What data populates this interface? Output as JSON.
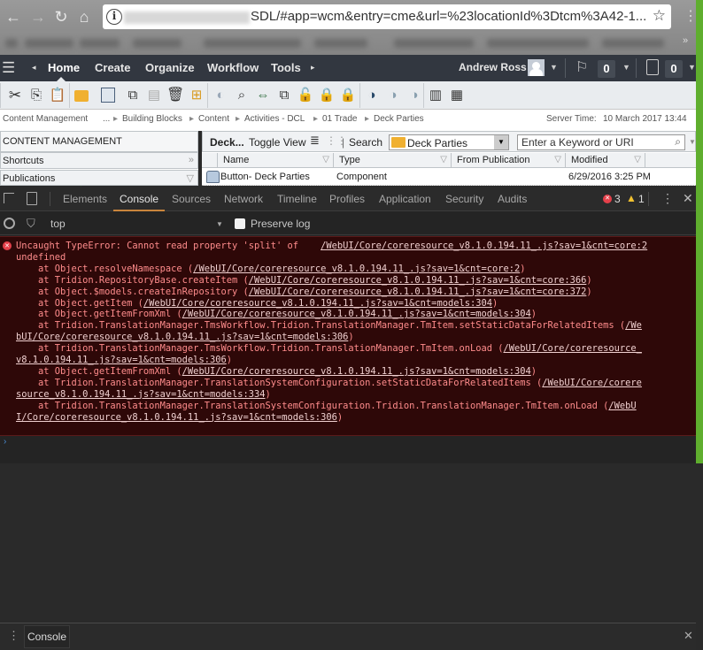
{
  "browser": {
    "url_visible": "SDL/#app=wcm&entry=cme&url=%23locationId%3Dtcm%3A42-1...",
    "more_bookmarks": "»"
  },
  "app_header": {
    "tabs": [
      "Home",
      "Create",
      "Organize",
      "Workflow",
      "Tools"
    ],
    "active_tab": "Home",
    "user_name": "Andrew Ross",
    "flag_count": "0",
    "clipboard_count": "0"
  },
  "toolbar": {
    "icons": [
      "cut",
      "copy",
      "paste",
      "upload-folder",
      "structure",
      "where-used",
      "clipboard",
      "delete",
      "add-item",
      "publish-globe",
      "preview",
      "compare",
      "localize",
      "unlock",
      "lock",
      "checkin",
      "publish-page",
      "publish-green",
      "unpublish-red",
      "barcode-add",
      "barcode-check"
    ]
  },
  "breadcrumb": {
    "root": "Content Management",
    "items": [
      "...",
      "Building Blocks",
      "Content",
      "Activities - DCL",
      "01 Trade",
      "Deck Parties"
    ],
    "server_time_label": "Server Time:",
    "server_time": "10 March 2017 13:44"
  },
  "left_panel": {
    "title": "CONTENT MANAGEMENT",
    "shortcuts": "Shortcuts",
    "publications": "Publications"
  },
  "right_panel": {
    "folder_short": "Deck...",
    "toggle_view": "Toggle View",
    "search_label": "Search",
    "folder_value": "Deck Parties",
    "keyword_placeholder": "Enter a Keyword or URI",
    "columns": [
      "Name",
      "Type",
      "From Publication",
      "Modified"
    ],
    "rows": [
      {
        "name": "Button- Deck Parties",
        "type": "Component",
        "from_publication": "",
        "modified": "6/29/2016 3:25 PM"
      }
    ]
  },
  "devtools": {
    "tabs": [
      "Elements",
      "Console",
      "Sources",
      "Network",
      "Timeline",
      "Profiles",
      "Application",
      "Security",
      "Audits"
    ],
    "active_tab": "Console",
    "error_count": "3",
    "warning_count": "1",
    "context": "top",
    "preserve_log": "Preserve log",
    "console_lines": [
      {
        "t": "Uncaught TypeError: Cannot read property 'split' of    ",
        "u": "/WebUI/Core/coreresource_v8.1.0.194.11_.js?sav=1&cnt=core:2"
      },
      {
        "t": "undefined",
        "u": ""
      },
      {
        "t": "    at Object.resolveNamespace (",
        "u": "/WebUI/Core/coreresource_v8.1.0.194.11_.js?sav=1&cnt=core:2",
        "e": ")"
      },
      {
        "t": "    at Tridion.RepositoryBase.createItem (",
        "u": "/WebUI/Core/coreresource_v8.1.0.194.11_.js?sav=1&cnt=core:366",
        "e": ")"
      },
      {
        "t": "    at Object.$models.createInRepository (",
        "u": "/WebUI/Core/coreresource_v8.1.0.194.11_.js?sav=1&cnt=core:372",
        "e": ")"
      },
      {
        "t": "    at Object.getItem (",
        "u": "/WebUI/Core/coreresource_v8.1.0.194.11_.js?sav=1&cnt=models:304",
        "e": ")"
      },
      {
        "t": "    at Object.getItemFromXml (",
        "u": "/WebUI/Core/coreresource_v8.1.0.194.11_.js?sav=1&cnt=models:304",
        "e": ")"
      },
      {
        "t": "    at Tridion.TranslationManager.TmsWorkflow.Tridion.TranslationManager.TmItem.setStaticDataForRelatedItems (",
        "u": "/We",
        "e": ""
      },
      {
        "t": "",
        "u": "bUI/Core/coreresource_v8.1.0.194.11_.js?sav=1&cnt=models:306",
        "e": ")"
      },
      {
        "t": "    at Tridion.TranslationManager.TmsWorkflow.Tridion.TranslationManager.TmItem.onLoad (",
        "u": "/WebUI/Core/coreresource_",
        "e": ""
      },
      {
        "t": "",
        "u": "v8.1.0.194.11_.js?sav=1&cnt=models:306",
        "e": ")"
      },
      {
        "t": "    at Object.getItemFromXml (",
        "u": "/WebUI/Core/coreresource_v8.1.0.194.11_.js?sav=1&cnt=models:304",
        "e": ")"
      },
      {
        "t": "    at Tridion.TranslationManager.TranslationSystemConfiguration.setStaticDataForRelatedItems (",
        "u": "/WebUI/Core/corere",
        "e": ""
      },
      {
        "t": "",
        "u": "source_v8.1.0.194.11_.js?sav=1&cnt=models:334",
        "e": ")"
      },
      {
        "t": "    at Tridion.TranslationManager.TranslationSystemConfiguration.Tridion.TranslationManager.TmItem.onLoad (",
        "u": "/WebU",
        "e": ""
      },
      {
        "t": "",
        "u": "I/Core/coreresource_v8.1.0.194.11_.js?sav=1&cnt=models:306",
        "e": ")"
      }
    ],
    "drawer_tab": "Console"
  }
}
